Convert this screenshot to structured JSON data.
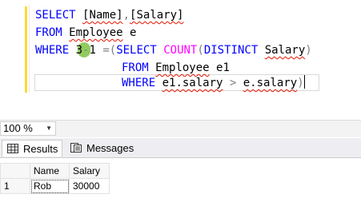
{
  "editor": {
    "line1": [
      "SELECT",
      " ",
      "[Name]",
      ",",
      "[Salary]"
    ],
    "line2": [
      "FROM",
      " ",
      "Employee",
      " e"
    ],
    "line3": [
      "WHERE",
      " ",
      "3",
      "-",
      "1",
      " =(",
      "SELECT",
      " ",
      "COUNT",
      "(",
      "DISTINCT",
      " ",
      "Salary",
      ")"
    ],
    "line4": [
      "FROM",
      " ",
      "Employee",
      " e1"
    ],
    "line5": [
      "WHERE",
      " ",
      "e1.salary",
      " > ",
      "e.salary",
      ")"
    ]
  },
  "zoom": {
    "value": "100 %"
  },
  "tabs": {
    "results": "Results",
    "messages": "Messages"
  },
  "grid": {
    "columns": [
      "Name",
      "Salary"
    ],
    "rows": [
      {
        "num": "1",
        "name": "Rob",
        "salary": "30000"
      }
    ]
  },
  "colors": {
    "keyword": "#0000ff",
    "function": "#ff00ff",
    "operator": "#808080",
    "squiggle": "#e51400",
    "marker": "#7dc242"
  },
  "icons": {
    "results": "grid-icon",
    "messages": "messages-icon"
  }
}
